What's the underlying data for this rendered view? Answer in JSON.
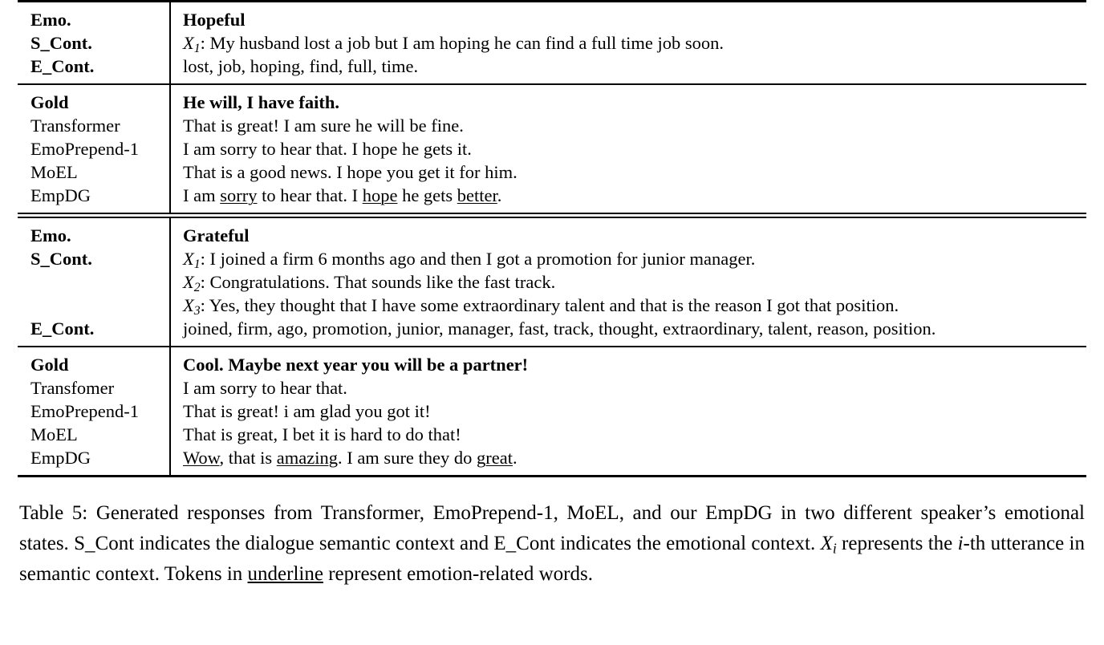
{
  "table": {
    "label_id": "Table 5",
    "blocks": [
      {
        "id": "example-1-context",
        "rows": [
          {
            "label": "Emo.",
            "label_bold": true,
            "text": "Hopeful",
            "bold": true
          },
          {
            "label": "S_Cont.",
            "label_bold": true,
            "prefix": "X",
            "sub": "1",
            "text": ":  My husband lost a job but I am hoping he can find a full time job soon.",
            "bold": false
          },
          {
            "label": "E_Cont.",
            "label_bold": true,
            "text": "lost, job, hoping, find, full, time.",
            "bold": false
          }
        ]
      },
      {
        "id": "example-1-responses",
        "rows": [
          {
            "label": "Gold",
            "label_bold": true,
            "text": "He will, I have faith.",
            "bold": true
          },
          {
            "label": "Transformer",
            "label_bold": false,
            "text": "That is great! I am sure he will be fine.",
            "bold": false
          },
          {
            "label": "EmoPrepend-1",
            "label_bold": false,
            "text": "I am sorry to hear that. I hope he gets it.",
            "bold": false
          },
          {
            "label": "MoEL",
            "label_bold": false,
            "text": "That is a good news. I hope you get it for him.",
            "bold": false
          },
          {
            "label": "EmpDG",
            "label_bold": false,
            "text": "I am sorry to hear that. I hope he gets better.",
            "bold": false,
            "underline_words": [
              "sorry",
              "hope",
              "better"
            ]
          }
        ]
      },
      {
        "id": "example-2-context",
        "rows": [
          {
            "label": "Emo.",
            "label_bold": true,
            "text": "Grateful",
            "bold": true
          },
          {
            "label": "S_Cont.",
            "label_bold": true,
            "prefix": "X",
            "sub": "1",
            "text": ": I joined a firm 6 months ago and then I got a promotion for junior manager.",
            "bold": false
          },
          {
            "label": "",
            "label_bold": false,
            "prefix": "X",
            "sub": "2",
            "text": ": Congratulations. That sounds like the fast track.",
            "bold": false
          },
          {
            "label": "",
            "label_bold": false,
            "prefix": "X",
            "sub": "3",
            "text": ": Yes, they thought that I have some extraordinary talent and that is the reason I got that position.",
            "bold": false
          },
          {
            "label": "E_Cont.",
            "label_bold": true,
            "text": "joined, firm, ago, promotion, junior, manager, fast, track, thought, extraordinary, talent, reason, position.",
            "bold": false
          }
        ]
      },
      {
        "id": "example-2-responses",
        "rows": [
          {
            "label": "Gold",
            "label_bold": true,
            "text": "Cool. Maybe next year you will be a partner!",
            "bold": true
          },
          {
            "label": "Transfomer",
            "label_bold": false,
            "text": "I am sorry to hear that.",
            "bold": false
          },
          {
            "label": "EmoPrepend-1",
            "label_bold": false,
            "text": "That is great! i am glad you got it!",
            "bold": false
          },
          {
            "label": "MoEL",
            "label_bold": false,
            "text": "That is great, I bet it is hard to do that!",
            "bold": false
          },
          {
            "label": "EmpDG",
            "label_bold": false,
            "text": "Wow, that is amazing. I am sure they do great.",
            "bold": false,
            "underline_words": [
              "Wow",
              "amazing",
              "great"
            ]
          }
        ]
      }
    ]
  },
  "caption": {
    "part1": "Table 5: Generated responses from Transformer, EmoPrepend-1, MoEL, and our EmpDG in two different speaker’s emotional states. S_Cont indicates the dialogue semantic context and E_Cont indicates the emotional context. ",
    "math_x": "X",
    "math_sub": "i",
    "part2": " represents the ",
    "math_i": "i",
    "part3": "-th utterance in semantic context. Tokens in ",
    "underlined": "underline",
    "part4": " represent emotion-related words."
  }
}
